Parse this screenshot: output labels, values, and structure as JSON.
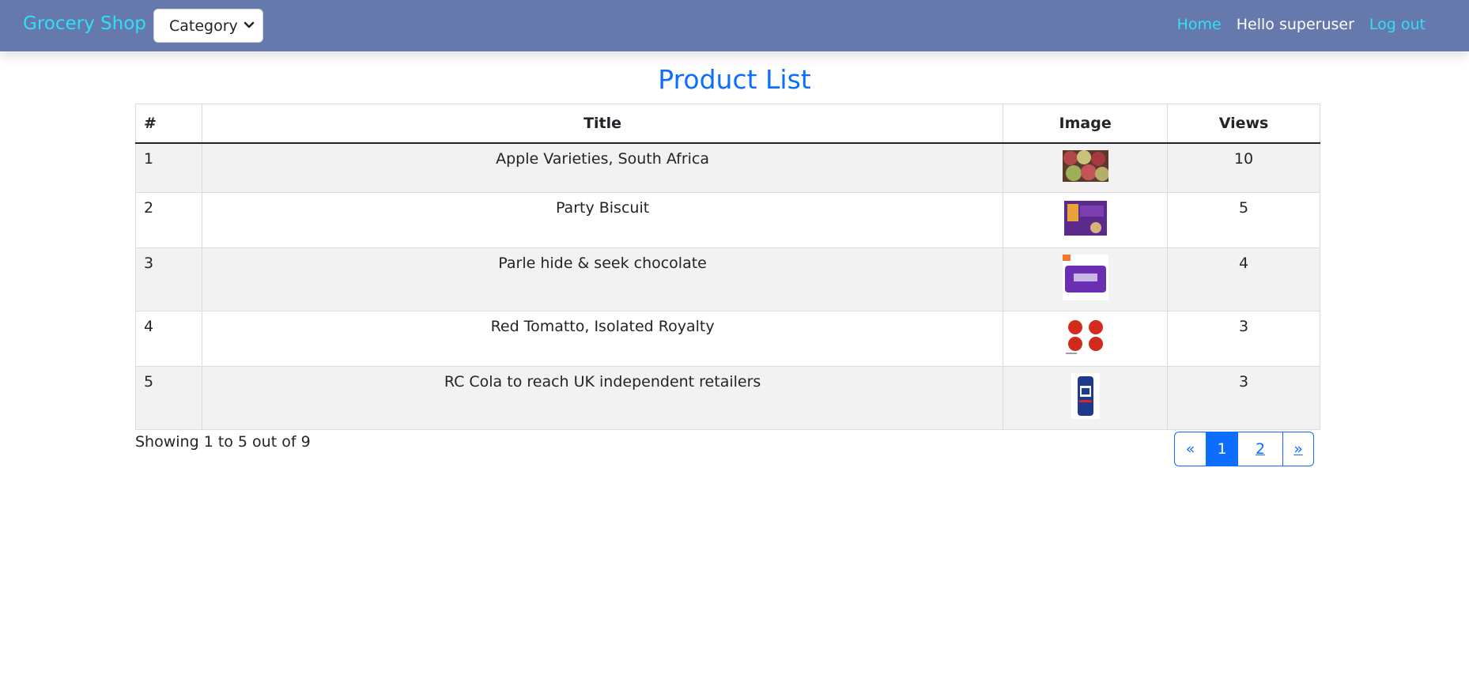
{
  "navbar": {
    "brand": "Grocery Shop",
    "category_select": "Category",
    "home_link": "Home",
    "greeting": "Hello superuser",
    "logout_link": "Log out",
    "colors": {
      "bar": "#6579ad",
      "link": "#2fe0f5"
    }
  },
  "page": {
    "title": "Product List"
  },
  "table": {
    "headers": [
      "#",
      "Title",
      "Image",
      "Views"
    ],
    "rows": [
      {
        "num": "1",
        "title": "Apple Varieties, South Africa",
        "image": "apples-thumbnail",
        "views": "10"
      },
      {
        "num": "2",
        "title": "Party Biscuit",
        "image": "biscuit-box-thumbnail",
        "views": "5"
      },
      {
        "num": "3",
        "title": "Parle hide & seek chocolate",
        "image": "chocolate-pack-thumbnail",
        "views": "4"
      },
      {
        "num": "4",
        "title": "Red Tomatto, Isolated Royalty",
        "image": "tomatoes-thumbnail",
        "views": "3"
      },
      {
        "num": "5",
        "title": "RC Cola to reach UK independent retailers",
        "image": "cola-can-thumbnail",
        "views": "3"
      }
    ]
  },
  "footer": {
    "showing": "Showing 1 to 5 out of 9",
    "pagination": {
      "prev": "«",
      "pages": [
        "1",
        "2"
      ],
      "current": "1",
      "next": "»"
    }
  }
}
